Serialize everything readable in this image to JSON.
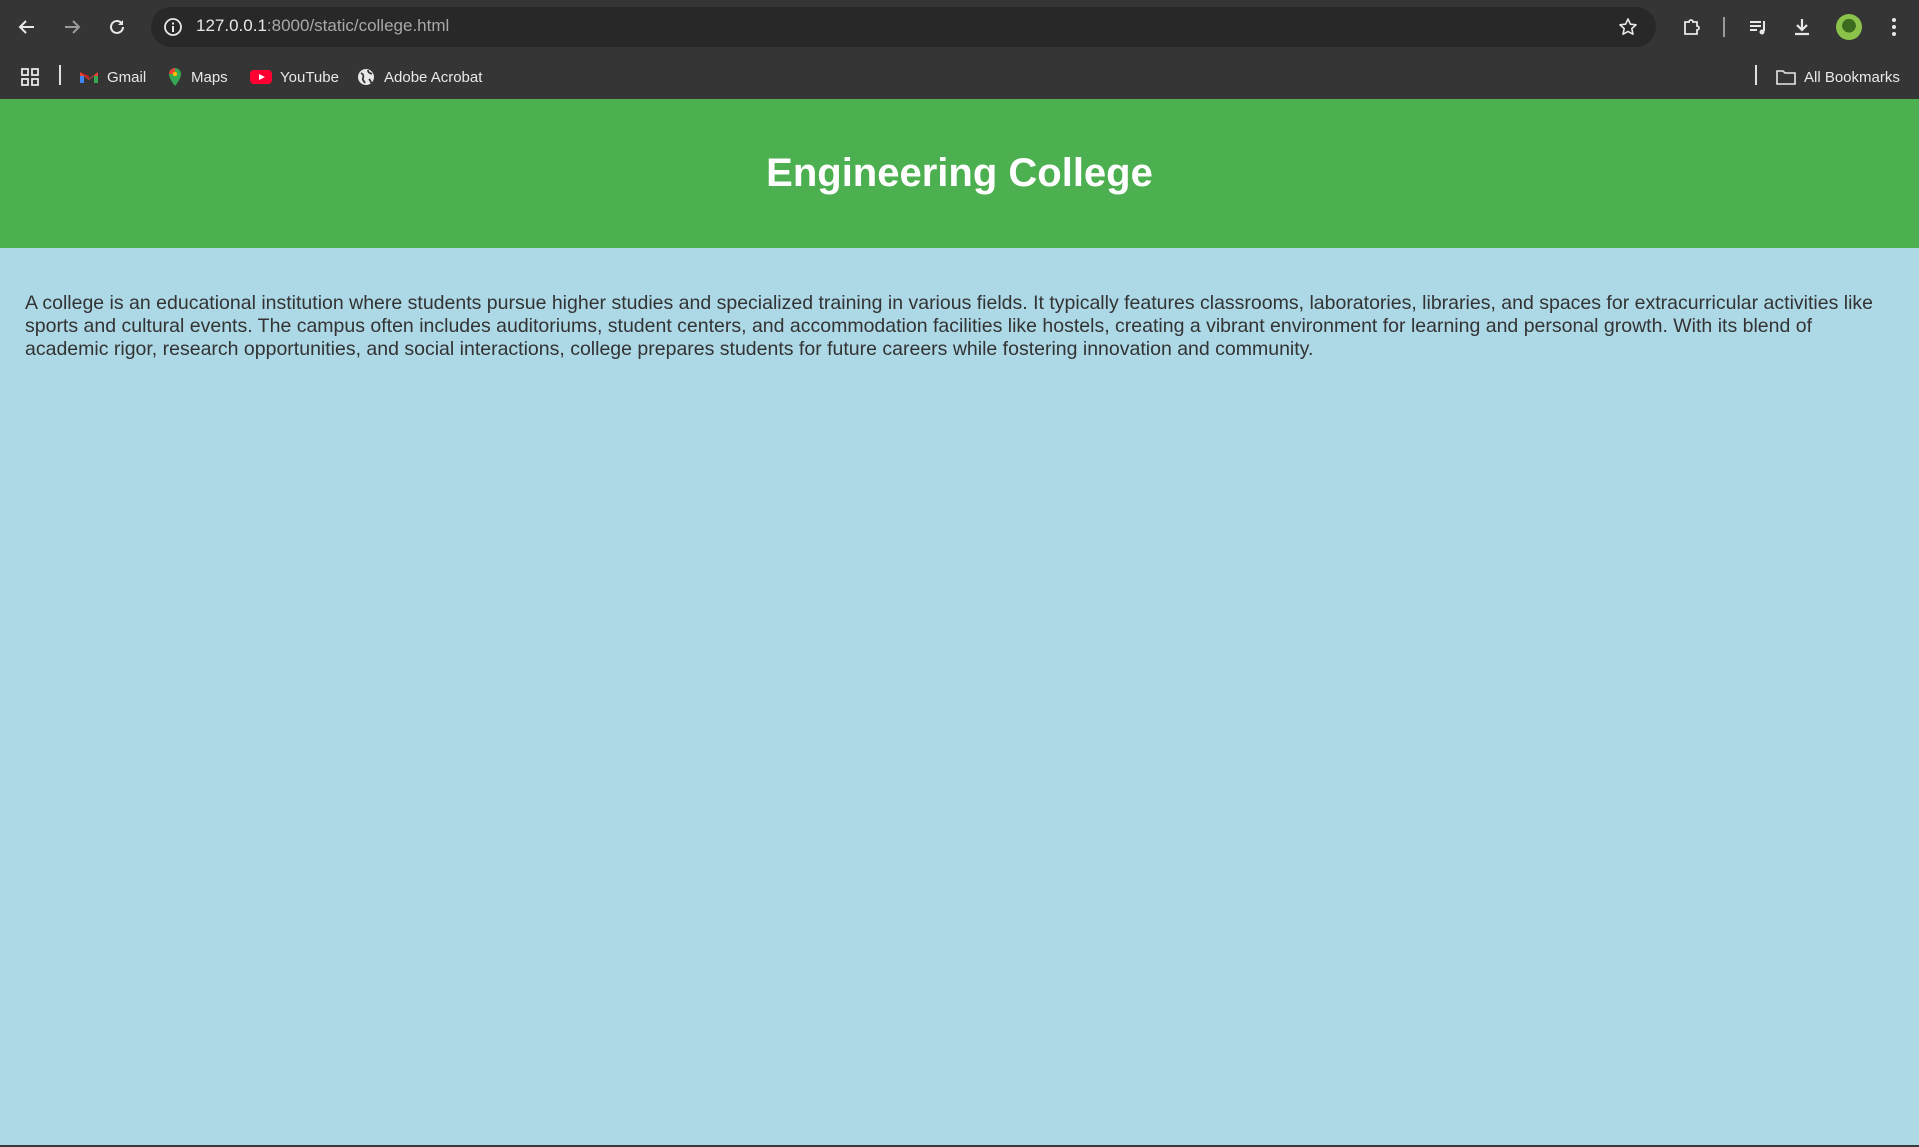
{
  "browser": {
    "url_host": "127.0.0.1",
    "url_rest": ":8000/static/college.html",
    "icons": {
      "back": "back-arrow-icon",
      "forward": "forward-arrow-icon",
      "reload": "reload-icon",
      "site_info": "info-icon",
      "bookmark_star": "star-icon",
      "extensions": "puzzle-icon",
      "media": "media-queue-icon",
      "downloads": "download-icon",
      "menu": "kebab-menu-icon"
    }
  },
  "bookmarks": {
    "items": [
      {
        "label": "Gmail",
        "icon": "gmail-icon"
      },
      {
        "label": "Maps",
        "icon": "maps-pin-icon"
      },
      {
        "label": "YouTube",
        "icon": "youtube-icon"
      },
      {
        "label": "Adobe Acrobat",
        "icon": "globe-icon"
      }
    ],
    "all_bookmarks": "All Bookmarks"
  },
  "page": {
    "title": "Engineering College",
    "paragraph": "A college is an educational institution where students pursue higher studies and specialized training in various fields. It typically features classrooms, laboratories, libraries, and spaces for extracurricular activities like sports and cultural events. The campus often includes auditoriums, student centers, and accommodation facilities like hostels, creating a vibrant environment for learning and personal growth. With its blend of academic rigor, research opportunities, and social interactions, college prepares students for future careers while fostering innovation and community.",
    "colors": {
      "header_bg": "#4caf50",
      "body_bg": "#add8e6",
      "title_text": "#ffffff",
      "body_text": "#333333"
    }
  }
}
